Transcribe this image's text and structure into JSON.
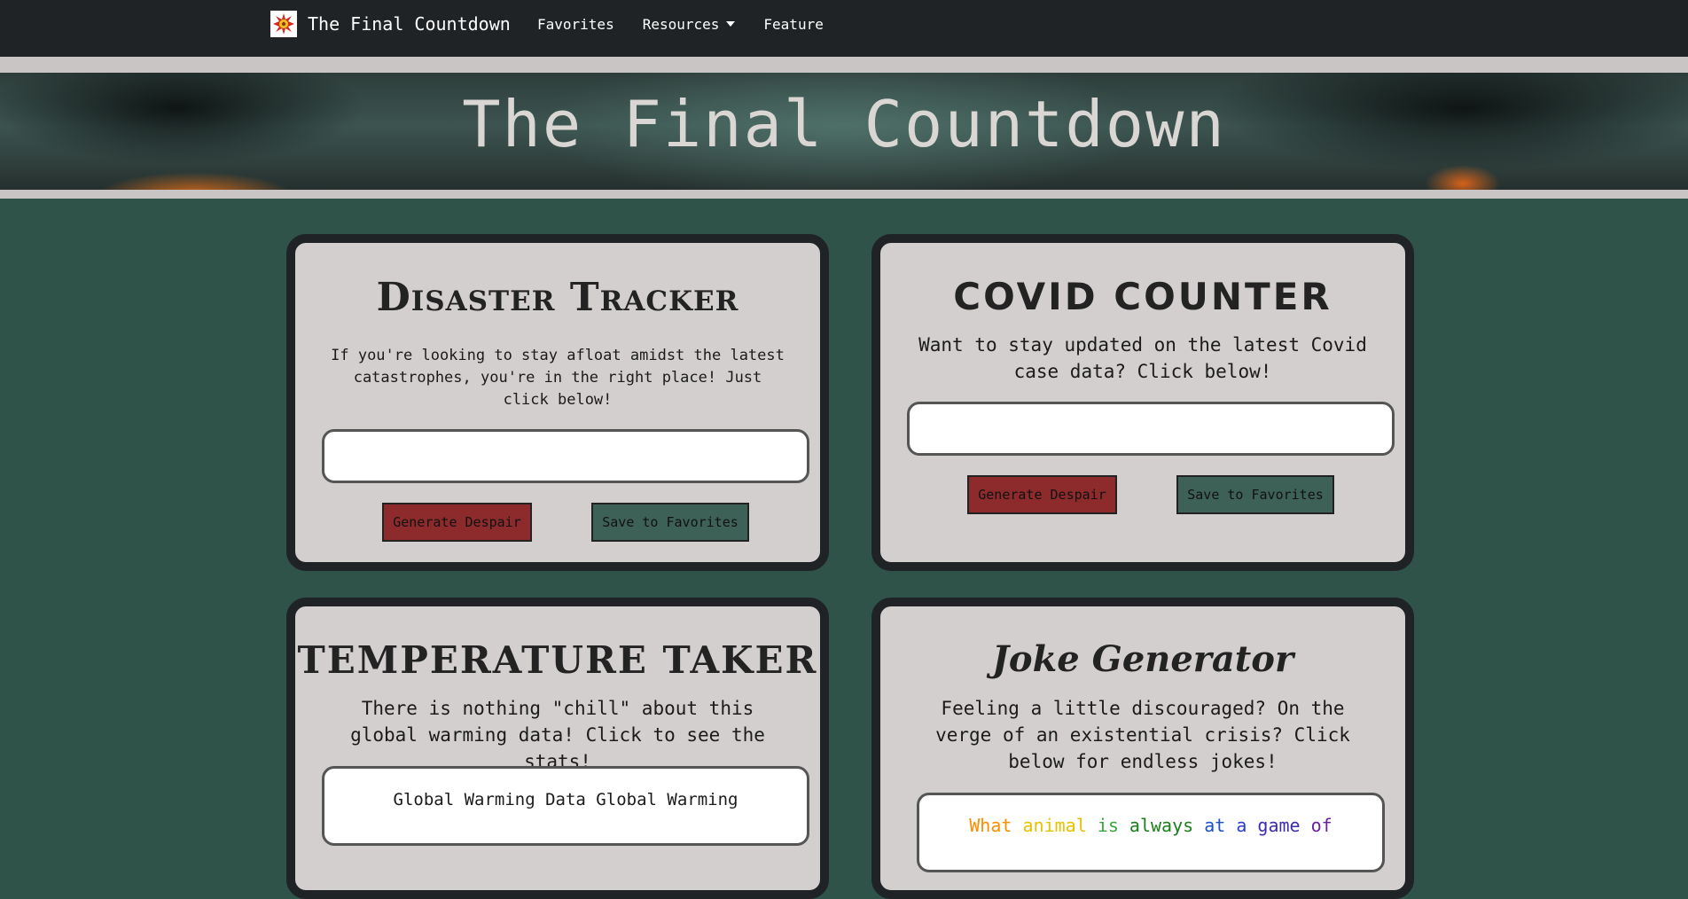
{
  "navbar": {
    "brand": "The Final Countdown",
    "links": [
      "Favorites",
      "Resources",
      "Feature"
    ]
  },
  "hero": {
    "title": "The Final Countdown"
  },
  "cards": {
    "disaster": {
      "title": "Disaster Tracker",
      "description": "If you're looking to stay afloat amidst the latest catastrophes, you're in the right place! Just click below!",
      "generate_label": "Generate Despair",
      "save_label": "Save to Favorites"
    },
    "covid": {
      "title": "COVID COUNTER",
      "description": "Want to stay updated on the latest Covid case data? Click below!",
      "generate_label": "Generate Despair",
      "save_label": "Save to Favorites"
    },
    "temperature": {
      "title": "TEMPERATURE TAKER",
      "description": "There is nothing \"chill\" about this global warming data! Click to see the stats!",
      "field_text": "Global Warming Data Global Warming"
    },
    "joke": {
      "title": "Joke Generator",
      "description": "Feeling a little discouraged? On the verge of an existential crisis? Click below for endless jokes!",
      "joke_words": [
        "What",
        "animal",
        "is",
        "always",
        "at",
        "a",
        "game",
        "of"
      ]
    }
  },
  "colors": {
    "page_bg": "#2f5249",
    "navbar_bg": "#1f2326",
    "card_bg": "#d3cfce",
    "generate_button": "#8c2a2c",
    "save_button": "#3d6157",
    "joke_word_colors": [
      "#ff8c00",
      "#e6c200",
      "#3aa63a",
      "#1a7f1a",
      "#1e50c8",
      "#2a3ccf",
      "#3d2bb0",
      "#6a1fa8"
    ]
  },
  "icons": {
    "brand_logo": "explosion-logo-icon",
    "resources_caret": "caret-down-icon"
  }
}
